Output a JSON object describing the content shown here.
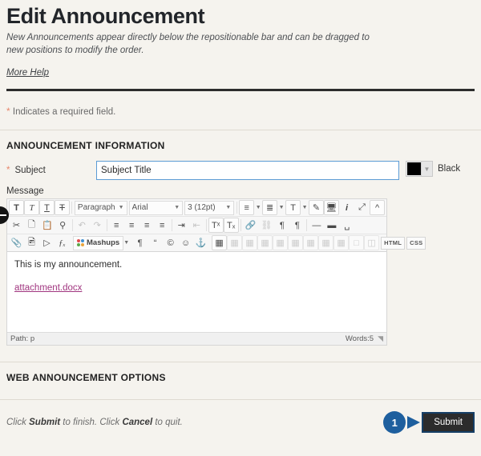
{
  "header": {
    "title": "Edit Announcement",
    "description": "New Announcements appear directly below the repositionable bar and can be dragged to new positions to modify the order.",
    "more_help": "More Help"
  },
  "required_note": {
    "star": "*",
    "text": "Indicates a required field."
  },
  "sections": {
    "announcement_information": "ANNOUNCEMENT INFORMATION",
    "web_announcement_options": "WEB ANNOUNCEMENT OPTIONS"
  },
  "subject": {
    "star": "*",
    "label": "Subject",
    "value": "Subject Title",
    "placeholder": "Subject Title",
    "color_name": "Black",
    "color_hex": "#000000"
  },
  "message": {
    "label": "Message",
    "body_text": "This is my announcement.",
    "attachment_link": "attachment.docx",
    "status_path": "Path: p",
    "status_words": "Words:5"
  },
  "editor_toolbar": {
    "row1": [
      {
        "name": "bold-button",
        "glyph": "T",
        "style": "bold"
      },
      {
        "name": "italic-button",
        "glyph": "T",
        "style": "italic"
      },
      {
        "name": "underline-button",
        "glyph": "T",
        "style": "underline"
      },
      {
        "name": "strikethrough-button",
        "glyph": "T",
        "style": "strike"
      }
    ],
    "paragraph_select": "Paragraph",
    "font_select": "Arial",
    "size_select": "3 (12pt)",
    "row1_right": [
      {
        "name": "bullet-list-button",
        "glyph": "☰"
      },
      {
        "name": "numbered-list-button",
        "glyph": "☷"
      },
      {
        "name": "text-color-button",
        "glyph": "T"
      },
      {
        "name": "highlight-pen-button",
        "glyph": "✎"
      },
      {
        "name": "preview-monitor-button",
        "glyph": "⬜"
      },
      {
        "name": "info-button",
        "glyph": "i"
      },
      {
        "name": "fullscreen-button",
        "glyph": "⬌"
      },
      {
        "name": "collapse-toolbar-button",
        "glyph": "∧"
      }
    ],
    "row2": [
      {
        "name": "cut-button",
        "glyph": "✂"
      },
      {
        "name": "copy-button",
        "glyph": "❐"
      },
      {
        "name": "paste-button",
        "glyph": "⎘"
      },
      {
        "name": "find-button",
        "glyph": "⌕"
      },
      {
        "name": "undo-button",
        "glyph": "↶"
      },
      {
        "name": "redo-button",
        "glyph": "↷"
      },
      {
        "name": "align-left-button",
        "glyph": "☰"
      },
      {
        "name": "align-center-button",
        "glyph": "☰"
      },
      {
        "name": "align-right-button",
        "glyph": "☰"
      },
      {
        "name": "justify-button",
        "glyph": "☰"
      },
      {
        "name": "indent-button",
        "glyph": "≡"
      },
      {
        "name": "outdent-button",
        "glyph": "≡"
      },
      {
        "name": "superscript-button",
        "glyph": "Tˣ"
      },
      {
        "name": "subscript-button",
        "glyph": "Tₓ"
      },
      {
        "name": "link-button",
        "glyph": "🔗"
      },
      {
        "name": "unlink-button",
        "glyph": "⛓"
      },
      {
        "name": "ltr-paragraph-button",
        "glyph": "¶"
      },
      {
        "name": "rtl-paragraph-button",
        "glyph": "¶"
      },
      {
        "name": "thin-rule-button",
        "glyph": "—"
      },
      {
        "name": "thick-rule-button",
        "glyph": "▂"
      },
      {
        "name": "nonbreaking-space-button",
        "glyph": "␣"
      }
    ],
    "row3": [
      {
        "name": "attach-file-button",
        "glyph": "📎"
      },
      {
        "name": "insert-image-button",
        "glyph": "☐"
      },
      {
        "name": "insert-media-button",
        "glyph": "▶"
      },
      {
        "name": "math-formula-button",
        "glyph": "ƒ"
      },
      {
        "name": "paragraph-mark-button",
        "glyph": "¶"
      },
      {
        "name": "quote-button",
        "glyph": "“"
      },
      {
        "name": "copyright-button",
        "glyph": "©"
      },
      {
        "name": "emoticon-button",
        "glyph": "☺"
      },
      {
        "name": "anchor-button",
        "glyph": "⚓"
      }
    ],
    "mashups_label": "Mashups",
    "table_buttons": 11,
    "html_button": "HTML",
    "css_button": "CSS"
  },
  "bottom": {
    "hint_prefix": "Click ",
    "hint_submit": "Submit",
    "hint_middle": " to finish. Click ",
    "hint_cancel": "Cancel",
    "hint_suffix": " to quit.",
    "step_number": "1",
    "submit_label": "Submit"
  }
}
